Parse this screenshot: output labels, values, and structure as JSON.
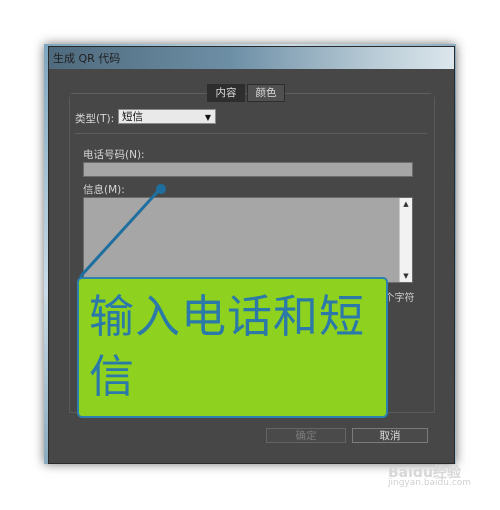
{
  "dialog": {
    "title": "生成 QR 代码",
    "tabs": [
      {
        "label": "内容",
        "active": true
      },
      {
        "label": "颜色",
        "active": false
      }
    ],
    "type_label": "类型(T):",
    "type_value": "短信",
    "phone_label": "电话号码(N):",
    "phone_value": "",
    "message_label": "信息(M):",
    "message_value": "",
    "char_count": "剩余 160 个字符",
    "ok_label": "确定",
    "cancel_label": "取消"
  },
  "annotation": {
    "text": "输入电话和短信"
  },
  "watermark": {
    "text": "Baidu经验",
    "sub": "jingyan.baidu.com"
  },
  "colors": {
    "dialog_bg": "#474747",
    "callout_bg": "#8ed11f",
    "callout_text": "#2b79a9",
    "pointer": "#1e6fa0"
  }
}
